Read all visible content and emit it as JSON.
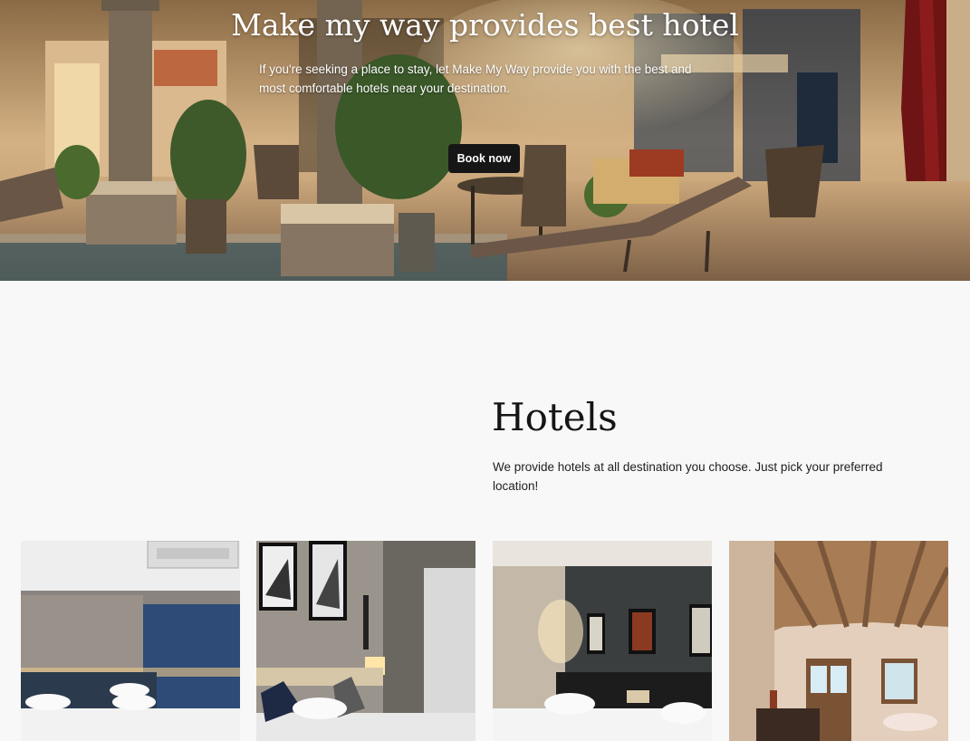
{
  "hero": {
    "title": "Make my way provides best hotel",
    "subtitle": "If you're seeking a place to stay, let Make My Way provide you with the best and most comfortable hotels near your destination.",
    "cta_label": "Book now"
  },
  "hotels": {
    "title": "Hotels",
    "description": "We provide hotels at all destination you choose. Just pick your preferred location!"
  },
  "colors": {
    "button_bg": "#161616",
    "page_bg": "#f8f8f8",
    "text_dark": "#151515"
  }
}
